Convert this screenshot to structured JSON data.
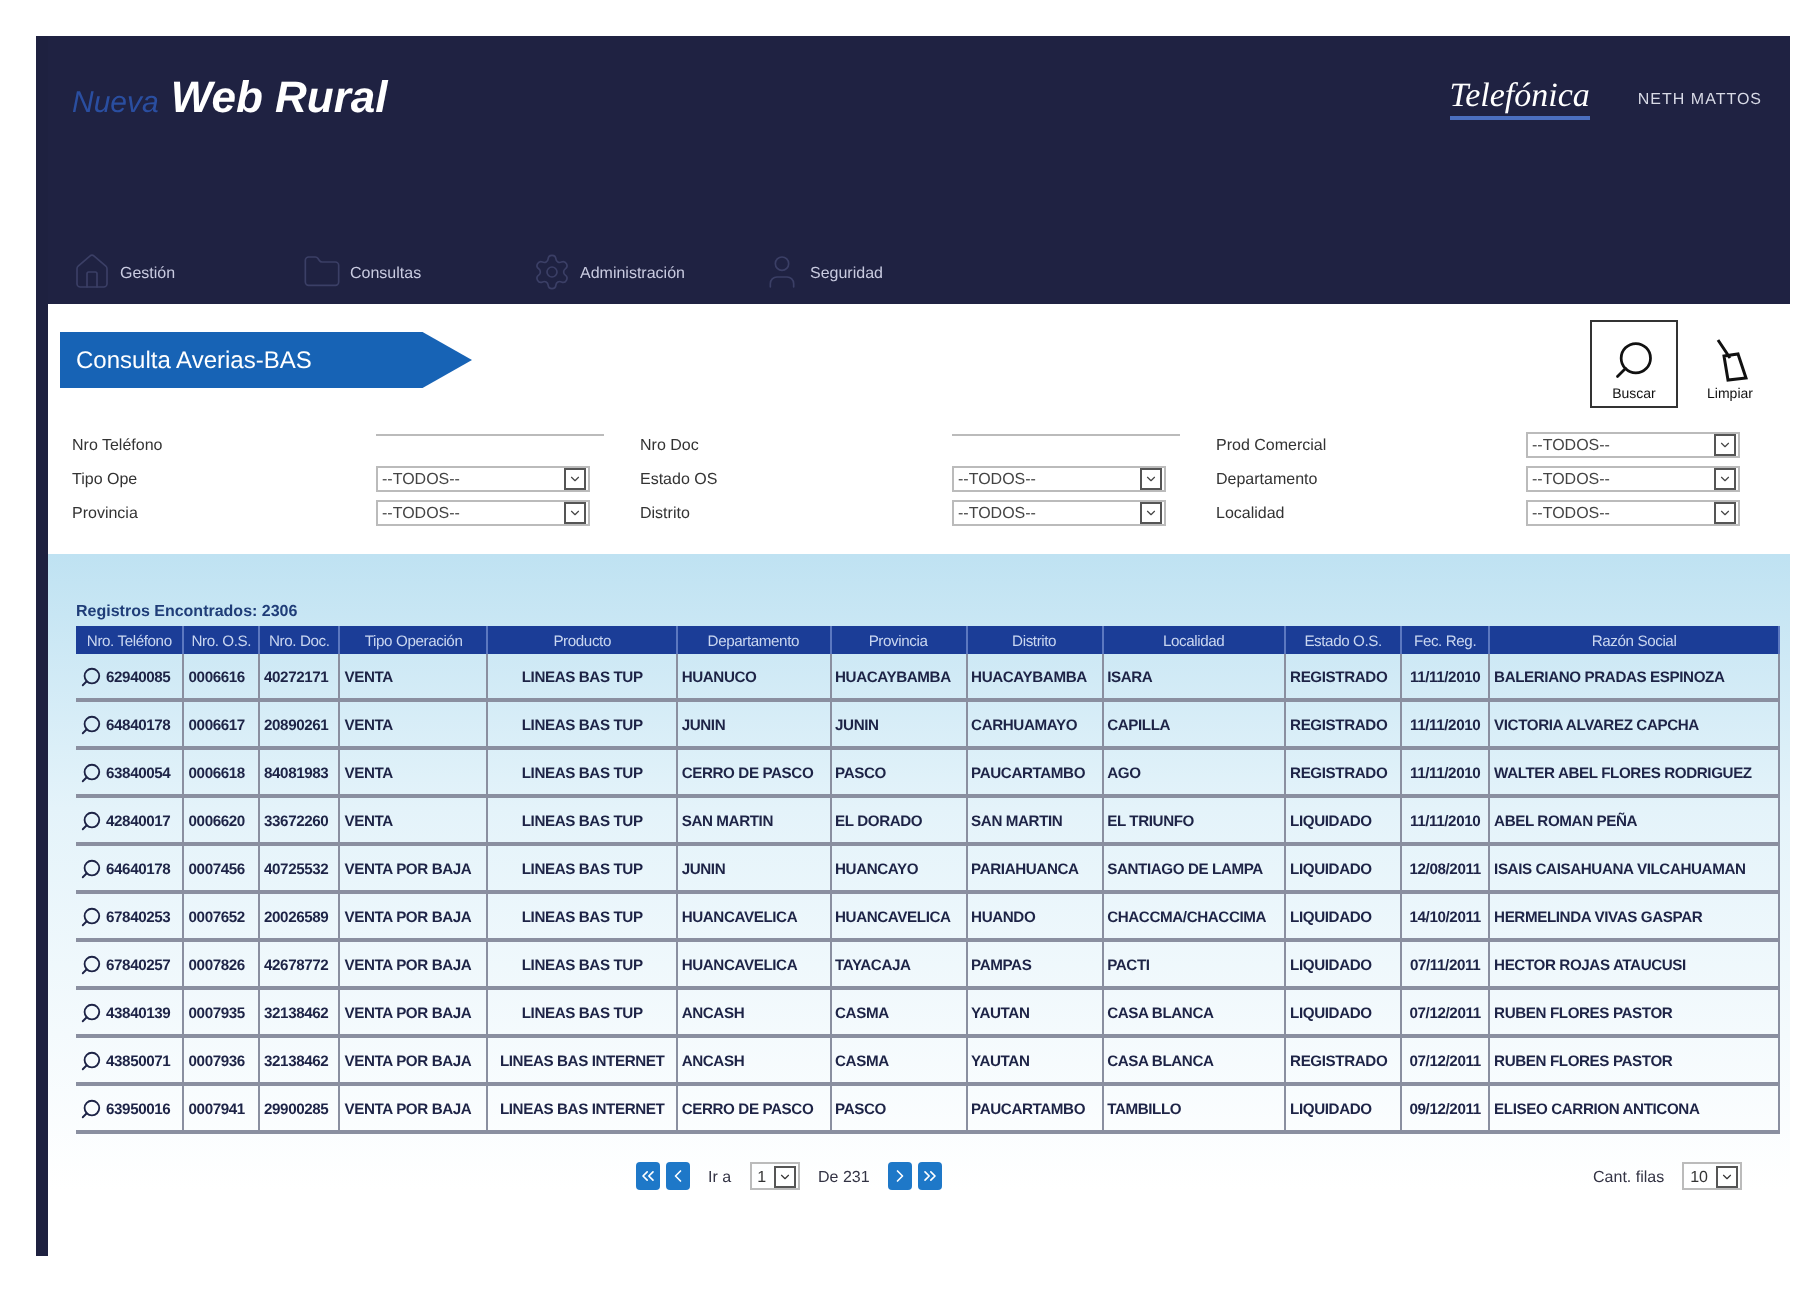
{
  "header": {
    "brand_prefix": "Nueva",
    "brand": "Web Rural",
    "logo": "Telefónica",
    "user": "NETH MATTOS"
  },
  "nav": [
    {
      "label": "Gestión"
    },
    {
      "label": "Consultas"
    },
    {
      "label": "Administración"
    },
    {
      "label": "Seguridad"
    }
  ],
  "page_title": "Consulta Averias-BAS",
  "actions": [
    {
      "label": "Buscar",
      "kind": "search"
    },
    {
      "label": "Limpiar",
      "kind": "clear"
    }
  ],
  "filters": [
    {
      "label": "Nro Teléfono",
      "kind": "input"
    },
    {
      "label": "Nro Doc",
      "kind": "input"
    },
    {
      "label": "Prod Comercial",
      "kind": "select",
      "value": "--TODOS--"
    },
    {
      "label": "Tipo Ope",
      "kind": "select",
      "value": "--TODOS--"
    },
    {
      "label": "Estado OS",
      "kind": "select",
      "value": "--TODOS--"
    },
    {
      "label": "Departamento",
      "kind": "select",
      "value": "--TODOS--"
    },
    {
      "label": "Provincia",
      "kind": "select",
      "value": "--TODOS--"
    },
    {
      "label": "Distrito",
      "kind": "select",
      "value": "--TODOS--"
    },
    {
      "label": "Localidad",
      "kind": "select",
      "value": "--TODOS--"
    }
  ],
  "results_label": "Registros Encontrados: 2306",
  "table": {
    "columns": [
      "Nro. Teléfono",
      "Nro. O.S.",
      "Nro. Doc.",
      "Tipo Operación",
      "Producto",
      "Departamento",
      "Provincia",
      "Distrito",
      "Localidad",
      "Estado O.S.",
      "Fec. Reg.",
      "Razón Social"
    ],
    "rows": [
      [
        "62940085",
        "0006616",
        "40272171",
        "VENTA",
        "LINEAS BAS TUP",
        "HUANUCO",
        "HUACAYBAMBA",
        "HUACAYBAMBA",
        "ISARA",
        "REGISTRADO",
        "11/11/2010",
        "BALERIANO PRADAS ESPINOZA"
      ],
      [
        "64840178",
        "0006617",
        "20890261",
        "VENTA",
        "LINEAS BAS TUP",
        "JUNIN",
        "JUNIN",
        "CARHUAMAYO",
        "CAPILLA",
        "REGISTRADO",
        "11/11/2010",
        "VICTORIA ALVAREZ CAPCHA"
      ],
      [
        "63840054",
        "0006618",
        "84081983",
        "VENTA",
        "LINEAS BAS TUP",
        "CERRO DE PASCO",
        "PASCO",
        "PAUCARTAMBO",
        "AGO",
        "REGISTRADO",
        "11/11/2010",
        "WALTER ABEL FLORES RODRIGUEZ"
      ],
      [
        "42840017",
        "0006620",
        "33672260",
        "VENTA",
        "LINEAS BAS TUP",
        "SAN MARTIN",
        "EL DORADO",
        "SAN MARTIN",
        "EL TRIUNFO",
        "LIQUIDADO",
        "11/11/2010",
        "ABEL ROMAN PEÑA"
      ],
      [
        "64640178",
        "0007456",
        "40725532",
        "VENTA POR BAJA",
        "LINEAS BAS TUP",
        "JUNIN",
        "HUANCAYO",
        "PARIAHUANCA",
        "SANTIAGO DE LAMPA",
        "LIQUIDADO",
        "12/08/2011",
        "ISAIS CAISAHUANA VILCAHUAMAN"
      ],
      [
        "67840253",
        "0007652",
        "20026589",
        "VENTA POR BAJA",
        "LINEAS BAS TUP",
        "HUANCAVELICA",
        "HUANCAVELICA",
        "HUANDO",
        "CHACCMA/CHACCIMA",
        "LIQUIDADO",
        "14/10/2011",
        "HERMELINDA VIVAS GASPAR"
      ],
      [
        "67840257",
        "0007826",
        "42678772",
        "VENTA POR BAJA",
        "LINEAS BAS TUP",
        "HUANCAVELICA",
        "TAYACAJA",
        "PAMPAS",
        "PACTI",
        "LIQUIDADO",
        "07/11/2011",
        "HECTOR ROJAS ATAUCUSI"
      ],
      [
        "43840139",
        "0007935",
        "32138462",
        "VENTA POR BAJA",
        "LINEAS BAS TUP",
        "ANCASH",
        "CASMA",
        "YAUTAN",
        "CASA BLANCA",
        "LIQUIDADO",
        "07/12/2011",
        "RUBEN FLORES PASTOR"
      ],
      [
        "43850071",
        "0007936",
        "32138462",
        "VENTA POR BAJA",
        "LINEAS BAS INTERNET",
        "ANCASH",
        "CASMA",
        "YAUTAN",
        "CASA BLANCA",
        "REGISTRADO",
        "07/12/2011",
        "RUBEN FLORES PASTOR"
      ],
      [
        "63950016",
        "0007941",
        "29900285",
        "VENTA POR BAJA",
        "LINEAS BAS INTERNET",
        "CERRO DE PASCO",
        "PASCO",
        "PAUCARTAMBO",
        "TAMBILLO",
        "LIQUIDADO",
        "09/12/2011",
        "ELISEO CARRION ANTICONA"
      ]
    ]
  },
  "pagination": {
    "goto_label": "Ir a",
    "page": "1",
    "total": "De 231",
    "rows_label": "Cant. filas",
    "rows_value": "10"
  }
}
